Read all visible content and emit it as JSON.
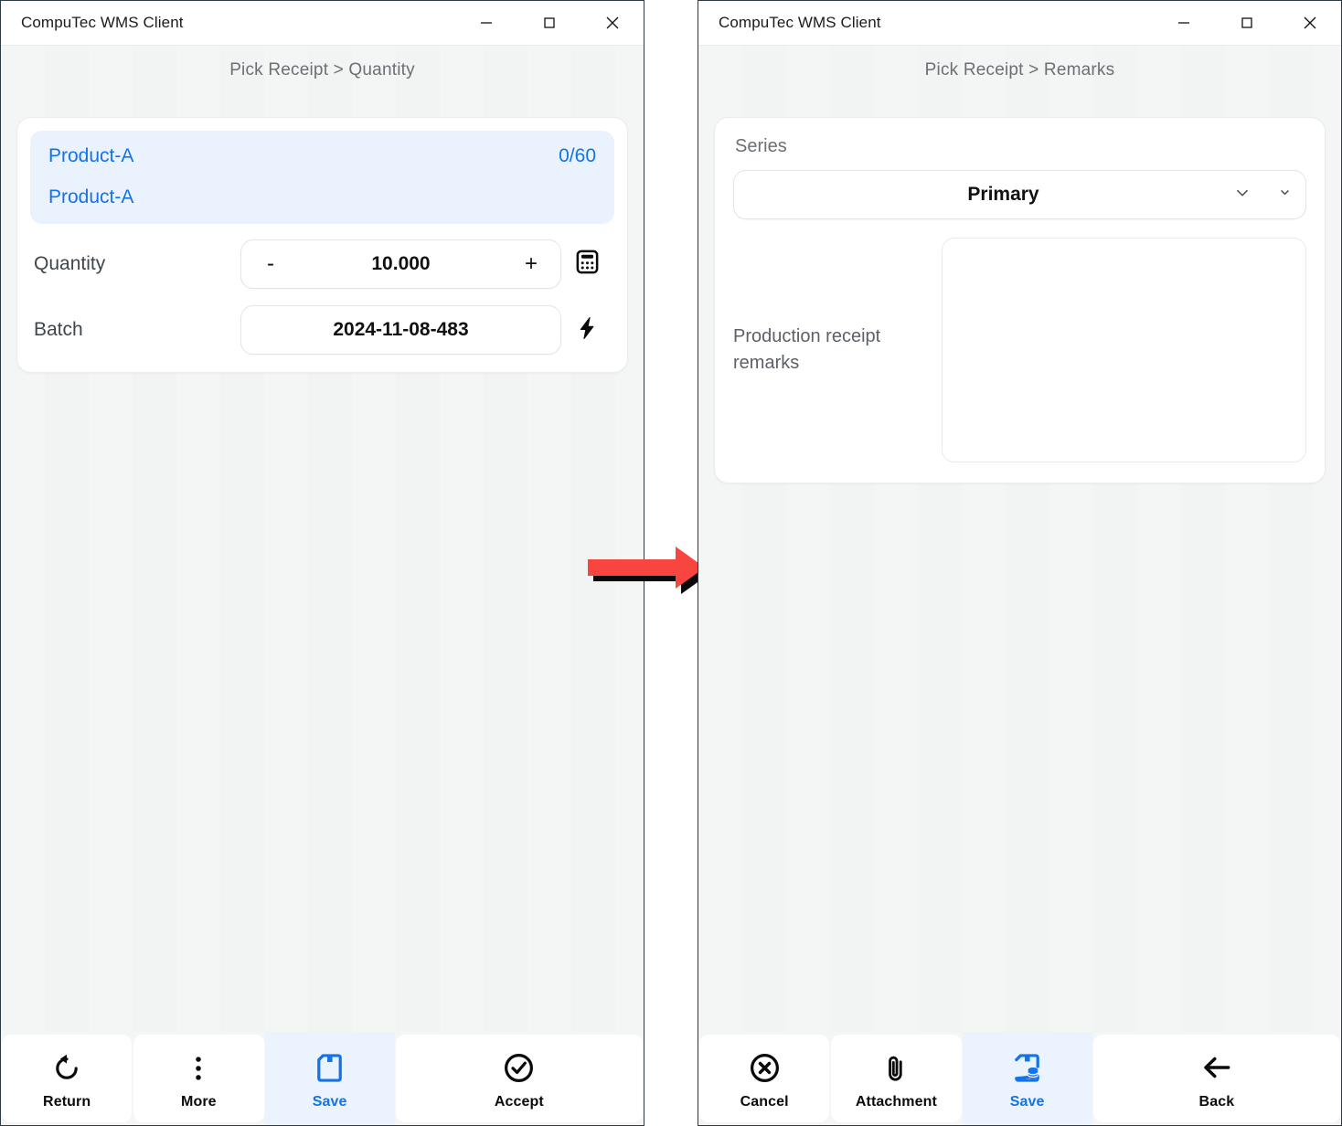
{
  "app": {
    "title": "CompuTec WMS Client"
  },
  "window_controls": {
    "minimize": "minimize-icon",
    "maximize": "maximize-icon",
    "close": "close-icon"
  },
  "colors": {
    "accent_blue": "#1473e6",
    "accent_blue_soft": "#eaf2fd",
    "active_tab_bg": "#eaf3fe",
    "arrow_red": "#f9453f",
    "text_dark": "#111111",
    "text_muted": "#6b7075",
    "panel_bg": "#f4f5f5",
    "card_bg": "#ffffff"
  },
  "left_window": {
    "breadcrumb": "Pick Receipt > Quantity",
    "product": {
      "name": "Product-A",
      "progress": "0/60",
      "description": "Product-A"
    },
    "fields": [
      {
        "label": "Quantity",
        "type": "stepper",
        "decrement": "-",
        "value": "10.000",
        "increment": "+",
        "side_icon": "calculator-icon"
      },
      {
        "label": "Batch",
        "type": "text",
        "value": "2024-11-08-483",
        "side_icon": "lightning-bolt-icon"
      }
    ],
    "toolbar": [
      {
        "label": "Return",
        "icon": "undo-rotate-icon",
        "active": false
      },
      {
        "label": "More",
        "icon": "dots-vertical-icon",
        "active": false
      },
      {
        "label": "Save",
        "icon": "floppy-disk-icon",
        "active": true
      },
      {
        "label": "Accept",
        "icon": "check-circle-icon",
        "active": false
      }
    ]
  },
  "right_window": {
    "breadcrumb": "Pick Receipt > Remarks",
    "series": {
      "label": "Series",
      "value": "Primary",
      "dropdown_icon": "chevron-down-icon",
      "expand_icon": "chevron-down-small-icon"
    },
    "remarks": {
      "label": "Production receipt remarks",
      "value": "",
      "placeholder": ""
    },
    "toolbar": [
      {
        "label": "Cancel",
        "icon": "close-circle-icon",
        "active": false
      },
      {
        "label": "Attachment",
        "icon": "paperclip-icon",
        "active": false
      },
      {
        "label": "Save",
        "icon": "floppy-disk-database-icon",
        "active": true
      },
      {
        "label": "Back",
        "icon": "arrow-left-icon",
        "active": false
      }
    ]
  },
  "annotation": {
    "arrow": "red-right-arrow",
    "meaning": "transition-from-quantity-to-remarks"
  }
}
